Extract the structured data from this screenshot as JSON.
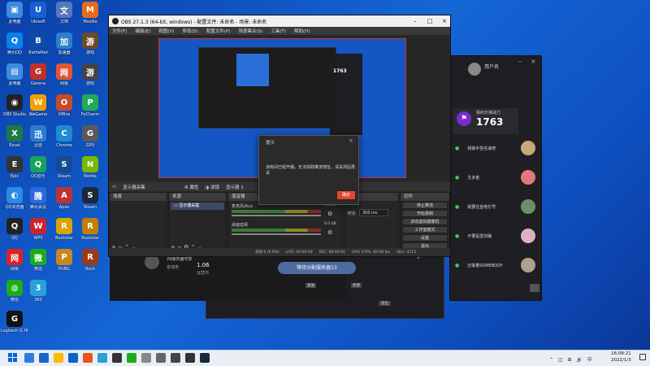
{
  "desktop": {
    "icons": [
      {
        "label": "此电脑",
        "color": "#3c8be0",
        "glyph": "▣"
      },
      {
        "label": "腾讯QQ",
        "color": "#0d7fe8",
        "glyph": "Q"
      },
      {
        "label": "此电脑",
        "color": "#3c8be0",
        "glyph": "▤"
      },
      {
        "label": "OBS Studio",
        "color": "#222",
        "glyph": "◉"
      },
      {
        "label": "Excel",
        "color": "#1d7a44",
        "glyph": "X"
      },
      {
        "label": "Epic",
        "color": "#333",
        "glyph": "E"
      },
      {
        "label": "QQ浏览器",
        "color": "#2a8ae8",
        "glyph": "◐"
      },
      {
        "label": "QQ",
        "color": "#222",
        "glyph": "Q"
      },
      {
        "label": "网易",
        "color": "#d22",
        "glyph": "网"
      },
      {
        "label": "微信",
        "color": "#1aad19",
        "glyph": "◍"
      },
      {
        "label": "Logitech G HUB",
        "color": "#111",
        "glyph": "G"
      }
    ],
    "col2": [
      "Ubisoft",
      "BattleNet",
      "Garena",
      "WeGame",
      "迅雷",
      "QQ音乐",
      "腾讯会议",
      "WPS",
      "微信",
      "360"
    ],
    "col3": [
      "文档",
      "加速器",
      "网易",
      "Office",
      "Chrome",
      "Steam",
      "Apex",
      "Rockstar",
      "PUBG"
    ],
    "col4": [
      "Mozilla",
      "游戏",
      "游戏",
      "PyCharm",
      "GPU",
      "Nvidia",
      "Steam",
      "Rockstar",
      "Rock"
    ]
  },
  "obs": {
    "title": "OBS 27.1.3 (64-bit, windows) - 配置文件: 未命名 - 场景: 未命名",
    "menu": [
      "文件(F)",
      "编辑(E)",
      "视图(V)",
      "停靠(D)",
      "配置文件(P)",
      "场景集合(S)",
      "工具(T)",
      "帮助(H)"
    ],
    "scene_bar": "显示器采集",
    "prop_btn": "属性",
    "filter_btn": "滤镜",
    "display_label": "显示器",
    "scene_dock": "场景",
    "source_dock": "来源",
    "source_item": "显示器采集",
    "mixer_dock": "混音器",
    "mixer_a": "麦克风/Aux",
    "mixer_a_db": "0.0 dB",
    "mixer_b": "桌面音频",
    "mixer_b_db": "0.0 dB",
    "trans_label": "转场",
    "duration_label": "时长",
    "duration": "300 ms",
    "controls_dock": "控件",
    "controls": [
      "停止推流",
      "开始录制",
      "启动虚拟摄像机",
      "工作室模式",
      "设置",
      "退出"
    ],
    "status": {
      "dropped": "丢帧 0 (0.0%)",
      "live": "LIVE: 00:00:00",
      "rec": "REC: 00:00:00",
      "cpu": "CPU: 0.9%, 60.00 fps",
      "kbps": "kb/s: 4713"
    }
  },
  "dialog": {
    "title": "提示",
    "message": "该房间已经开播，无法获取推流地址，请关闭后再试",
    "confirm": "确定"
  },
  "launcher": {
    "user_line1": "29服务器可享",
    "user_line2": "金瑞奥",
    "value": "1.06",
    "value_label": "运营商",
    "btn": "等待分配服务器13",
    "link1": "发送",
    "link2": "反馈",
    "link3": "退出"
  },
  "friends": {
    "username": "用户名",
    "rank_label": "我的天梯战力",
    "score": "1763",
    "list": [
      {
        "name": "我破手签名速奇",
        "color": "#caa67c"
      },
      {
        "name": "文多者",
        "color": "#e07a7a"
      },
      {
        "name": "我要在蓝电打号",
        "color": "#6a8f6a"
      },
      {
        "name": "不要是爱的路",
        "color": "#e0b0c0"
      },
      {
        "name": "迈掌着SOMEBODY",
        "color": "#b0a090"
      }
    ]
  },
  "taskbar": {
    "time": "16:08:21",
    "date": "2022/1/3"
  }
}
